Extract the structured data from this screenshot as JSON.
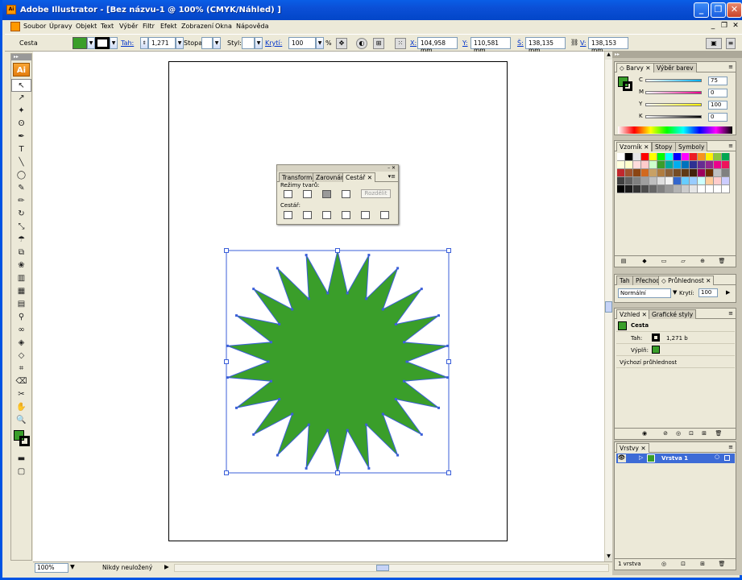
{
  "window": {
    "title": "Adobe Illustrator - [Bez názvu-1 @ 100% (CMYK/Náhled) ]",
    "app_icon_text": "Ai",
    "minimize": "_",
    "maximize": "❐",
    "close": "✕"
  },
  "menubar": {
    "items": [
      "Soubor",
      "Úpravy",
      "Objekt",
      "Text",
      "Výběr",
      "Filtr",
      "Efekt",
      "Zobrazení",
      "Okna",
      "Nápověda"
    ],
    "doc_minimize": "_",
    "doc_restore": "❐",
    "doc_close": "✕"
  },
  "control": {
    "selection_label": "Cesta",
    "fill_color": "#3a9e2a",
    "stroke_label": "Tah:",
    "stroke_weight": "1,271",
    "stopa_label": "Stopa:",
    "styl_label": "Styl:",
    "opacity_label": "Krytí:",
    "opacity_value": "100",
    "percent": "%",
    "x_label": "X:",
    "x_value": "104,958 mm",
    "y_label": "Y:",
    "y_value": "110,581 mm",
    "w_label": "Š:",
    "w_value": "138,135 mm",
    "h_label": "V:",
    "h_value": "138,153 mm"
  },
  "toolbox": {
    "logo": "Ai",
    "tools": [
      {
        "name": "selection-tool",
        "glyph": "↖"
      },
      {
        "name": "direct-selection-tool",
        "glyph": "↗"
      },
      {
        "name": "magic-wand-tool",
        "glyph": "✦"
      },
      {
        "name": "lasso-tool",
        "glyph": "ʘ"
      },
      {
        "name": "pen-tool",
        "glyph": "✒"
      },
      {
        "name": "type-tool",
        "glyph": "T"
      },
      {
        "name": "line-tool",
        "glyph": "╲"
      },
      {
        "name": "ellipse-tool",
        "glyph": "◯"
      },
      {
        "name": "paintbrush-tool",
        "glyph": "✎"
      },
      {
        "name": "pencil-tool",
        "glyph": "✏"
      },
      {
        "name": "rotate-tool",
        "glyph": "↻"
      },
      {
        "name": "scale-tool",
        "glyph": "⤡"
      },
      {
        "name": "warp-tool",
        "glyph": "☂"
      },
      {
        "name": "free-transform-tool",
        "glyph": "⧉"
      },
      {
        "name": "symbol-sprayer-tool",
        "glyph": "❀"
      },
      {
        "name": "graph-tool",
        "glyph": "▥"
      },
      {
        "name": "mesh-tool",
        "glyph": "▦"
      },
      {
        "name": "gradient-tool",
        "glyph": "▤"
      },
      {
        "name": "eyedropper-tool",
        "glyph": "⚲"
      },
      {
        "name": "blend-tool",
        "glyph": "∞"
      },
      {
        "name": "live-paint-tool",
        "glyph": "◈"
      },
      {
        "name": "live-paint-selection-tool",
        "glyph": "◇"
      },
      {
        "name": "slice-tool",
        "glyph": "⌗"
      },
      {
        "name": "eraser-tool",
        "glyph": "⌫"
      },
      {
        "name": "scissors-tool",
        "glyph": "✂"
      },
      {
        "name": "hand-tool",
        "glyph": "✋"
      },
      {
        "name": "zoom-tool",
        "glyph": "🔍"
      }
    ]
  },
  "canvas": {
    "shape_fill": "#3a9e2a",
    "selection_color": "#3b5fd9"
  },
  "status": {
    "zoom": "100%",
    "message": "Nikdy neuložený"
  },
  "pathfinder_panel": {
    "tabs": [
      "Transformace",
      "Zarovnání",
      "Cestář"
    ],
    "active_tab": "Cestář",
    "shape_modes_label": "Režimy tvarů:",
    "pathfinders_label": "Cestář:",
    "divide_button": "Rozdělit"
  },
  "color_panel": {
    "tabs": [
      "Barvy",
      "Výběr barev"
    ],
    "channels": [
      {
        "label": "C",
        "value": "75"
      },
      {
        "label": "M",
        "value": "0"
      },
      {
        "label": "Y",
        "value": "100"
      },
      {
        "label": "K",
        "value": "0"
      }
    ]
  },
  "swatches_panel": {
    "tabs": [
      "Vzorník",
      "Stopy",
      "Symboly"
    ]
  },
  "transparency_panel": {
    "tabs": [
      "Tah",
      "Přechod",
      "Průhlednost"
    ],
    "blend_mode": "Normální",
    "opacity_label": "Krytí:",
    "opacity_value": "100",
    "percent": "%"
  },
  "appearance_panel": {
    "tabs": [
      "Vzhled",
      "Grafické styly"
    ],
    "object_label": "Cesta",
    "stroke_label": "Tah:",
    "stroke_value": "1,271 b",
    "fill_label": "Výplň:",
    "default_opacity": "Výchozí průhlednost"
  },
  "layers_panel": {
    "tabs": [
      "Vrstvy"
    ],
    "layer_name": "Vrstva 1",
    "layer_count": "1 vrstva"
  }
}
